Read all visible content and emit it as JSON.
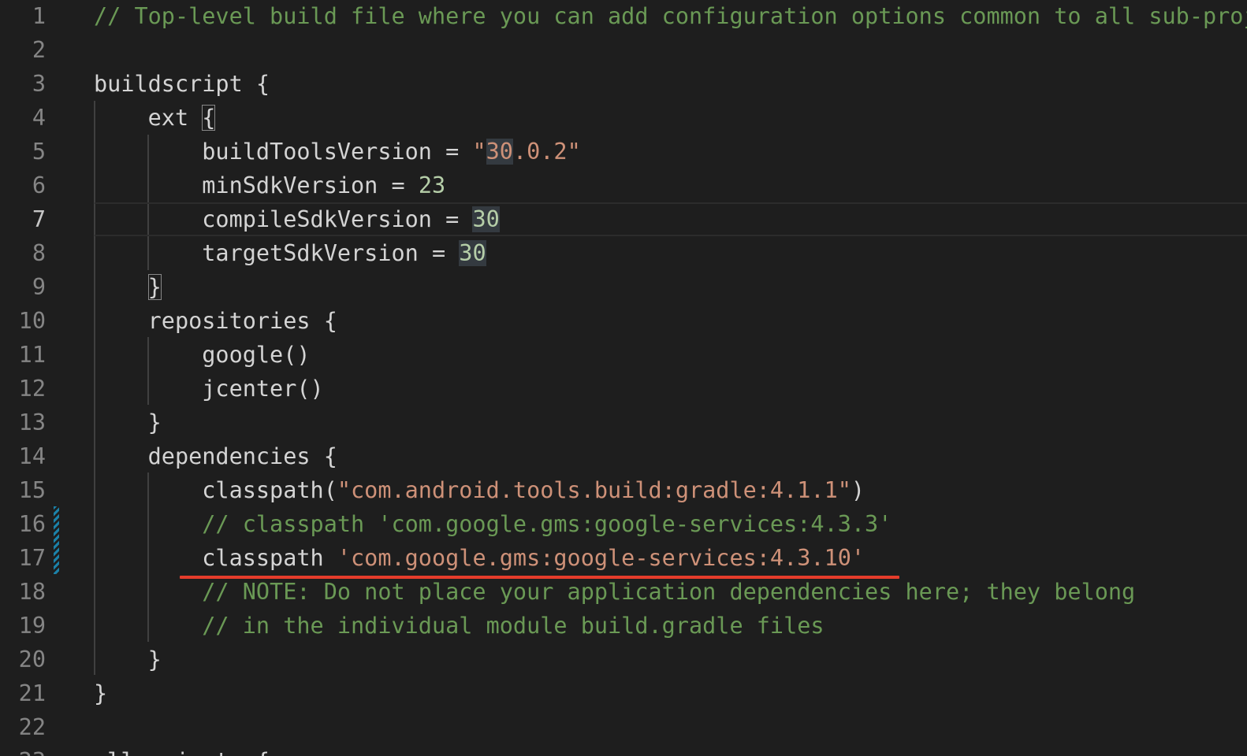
{
  "editor": {
    "colors": {
      "background": "#1e1e1e",
      "comment": "#6a9955",
      "string": "#ce9178",
      "number": "#b5cea8",
      "text": "#d4d4d4",
      "error_underline": "#e53c2b",
      "dirty_marker": "#1b81a8"
    },
    "current_line": 7,
    "lines": [
      {
        "n": "1",
        "tokens": [
          {
            "t": "// Top-level build file where you can add configuration options common to all sub-projects/modules.",
            "c": "comment"
          }
        ]
      },
      {
        "n": "2",
        "tokens": []
      },
      {
        "n": "3",
        "tokens": [
          {
            "t": "buildscript {",
            "c": "plain"
          }
        ]
      },
      {
        "n": "4",
        "tokens": [
          {
            "t": "    ext ",
            "c": "plain"
          },
          {
            "t": "{",
            "c": "plain",
            "bracket": true
          }
        ]
      },
      {
        "n": "5",
        "tokens": [
          {
            "t": "        buildToolsVersion = ",
            "c": "plain"
          },
          {
            "t": "\"",
            "c": "string"
          },
          {
            "t": "30",
            "c": "string",
            "hl": true
          },
          {
            "t": ".0.2\"",
            "c": "string"
          }
        ]
      },
      {
        "n": "6",
        "tokens": [
          {
            "t": "        minSdkVersion = ",
            "c": "plain"
          },
          {
            "t": "23",
            "c": "number"
          }
        ]
      },
      {
        "n": "7",
        "tokens": [
          {
            "t": "        compileSdkVersion = ",
            "c": "plain"
          },
          {
            "t": "30",
            "c": "number",
            "hl": true
          }
        ]
      },
      {
        "n": "8",
        "tokens": [
          {
            "t": "        targetSdkVersion = ",
            "c": "plain"
          },
          {
            "t": "30",
            "c": "number",
            "hl": true
          }
        ]
      },
      {
        "n": "9",
        "tokens": [
          {
            "t": "    ",
            "c": "plain"
          },
          {
            "t": "}",
            "c": "plain",
            "bracket": true
          }
        ]
      },
      {
        "n": "10",
        "tokens": [
          {
            "t": "    repositories {",
            "c": "plain"
          }
        ]
      },
      {
        "n": "11",
        "tokens": [
          {
            "t": "        google()",
            "c": "plain"
          }
        ]
      },
      {
        "n": "12",
        "tokens": [
          {
            "t": "        jcenter()",
            "c": "plain"
          }
        ]
      },
      {
        "n": "13",
        "tokens": [
          {
            "t": "    }",
            "c": "plain"
          }
        ]
      },
      {
        "n": "14",
        "tokens": [
          {
            "t": "    dependencies {",
            "c": "plain"
          }
        ]
      },
      {
        "n": "15",
        "tokens": [
          {
            "t": "        classpath(",
            "c": "plain"
          },
          {
            "t": "\"com.android.tools.build:gradle:4.1.1\"",
            "c": "string"
          },
          {
            "t": ")",
            "c": "plain"
          }
        ]
      },
      {
        "n": "16",
        "tokens": [
          {
            "t": "        // classpath 'com.google.gms:google-services:4.3.3'",
            "c": "comment"
          }
        ]
      },
      {
        "n": "17",
        "tokens": [
          {
            "t": "        classpath ",
            "c": "plain"
          },
          {
            "t": "'com.google.gms:google-services:4.3.10'",
            "c": "string"
          }
        ]
      },
      {
        "n": "18",
        "tokens": [
          {
            "t": "        // NOTE: Do not place your application dependencies here; they belong",
            "c": "comment"
          }
        ]
      },
      {
        "n": "19",
        "tokens": [
          {
            "t": "        // in the individual module build.gradle files",
            "c": "comment"
          }
        ]
      },
      {
        "n": "20",
        "tokens": [
          {
            "t": "    }",
            "c": "plain"
          }
        ]
      },
      {
        "n": "21",
        "tokens": [
          {
            "t": "}",
            "c": "plain"
          }
        ]
      },
      {
        "n": "22",
        "tokens": []
      },
      {
        "n": "23",
        "tokens": [
          {
            "t": "allprojects {",
            "c": "plain"
          }
        ]
      }
    ]
  }
}
